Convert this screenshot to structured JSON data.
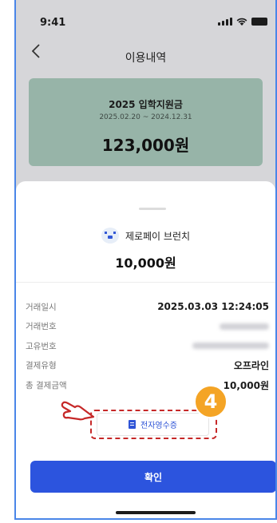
{
  "status_bar": {
    "time": "9:41"
  },
  "header": {
    "title": "이용내역",
    "back_icon": "chevron-left-icon"
  },
  "grant_card": {
    "title": "2025 입학지원금",
    "period": "2025.02.20 ~ 2024.12.31",
    "amount": "123,000원",
    "color": "#97b4a8"
  },
  "sheet": {
    "merchant_name": "제로페이 브런치",
    "merchant_icon": "zeropay-logo-icon",
    "amount": "10,000원"
  },
  "details": [
    {
      "label": "거래일시",
      "value": "2025.03.03  12:24:05"
    },
    {
      "label": "거래번호",
      "value": ""
    },
    {
      "label": "고유번호",
      "value": ""
    },
    {
      "label": "결제유형",
      "value": "오프라인"
    },
    {
      "label": "총 결제금액",
      "value": "10,000원"
    }
  ],
  "receipt_button": {
    "label": "전자영수증",
    "icon": "document-icon"
  },
  "step_badge": "4",
  "confirm_button": {
    "label": "확인",
    "color": "#2c54de"
  },
  "accent": {
    "highlight": "#c62828",
    "badge": "#f4a425"
  }
}
